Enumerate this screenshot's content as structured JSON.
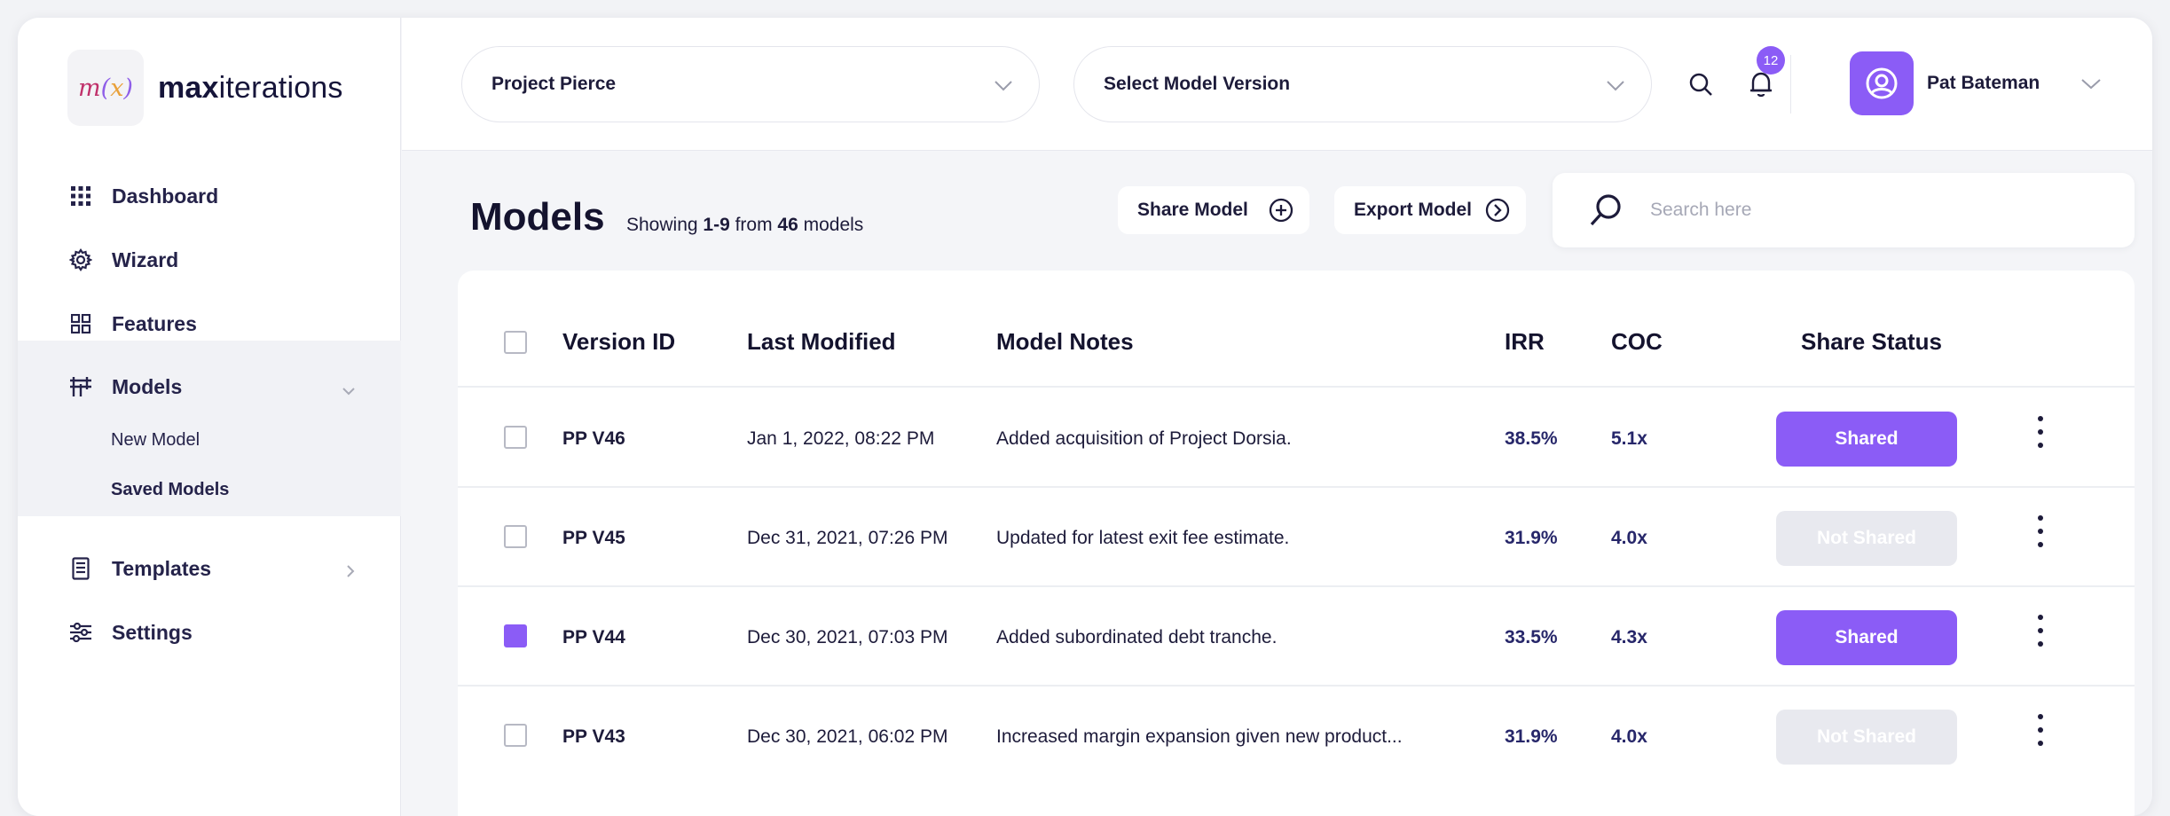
{
  "brand": {
    "logo_m": "m",
    "logo_open": "(",
    "logo_x": "x",
    "logo_close": ")",
    "name_bold": "max",
    "name_rest": "iterations"
  },
  "sidebar": {
    "items": [
      {
        "label": "Dashboard",
        "icon": "grid-dots-icon"
      },
      {
        "label": "Wizard",
        "icon": "gear-icon"
      },
      {
        "label": "Features",
        "icon": "layout-grid-icon"
      },
      {
        "label": "Models",
        "icon": "sliders-icon",
        "expanded": true
      },
      {
        "label": "Templates",
        "icon": "document-icon"
      },
      {
        "label": "Settings",
        "icon": "settings-sliders-icon"
      }
    ],
    "models_sub": [
      {
        "label": "New Model",
        "active": false
      },
      {
        "label": "Saved Models",
        "active": true
      }
    ]
  },
  "topbar": {
    "project_select": "Project Pierce",
    "version_select": "Select Model Version",
    "notification_count": "12",
    "user_name": "Pat Bateman"
  },
  "content": {
    "title": "Models",
    "showing_prefix": "Showing ",
    "showing_range": "1-9",
    "showing_mid": " from ",
    "showing_total": "46",
    "showing_suffix": " models",
    "share_button": "Share Model",
    "export_button": "Export Model",
    "search_placeholder": "Search here"
  },
  "table": {
    "headers": {
      "version_id": "Version ID",
      "last_modified": "Last Modified",
      "model_notes": "Model Notes",
      "irr": "IRR",
      "coc": "COC",
      "share_status": "Share Status"
    },
    "rows": [
      {
        "checked": false,
        "version_id": "PP V46",
        "last_modified": "Jan 1, 2022, 08:22 PM",
        "notes": "Added acquisition of Project Dorsia.",
        "irr": "38.5%",
        "coc": "5.1x",
        "status": "Shared"
      },
      {
        "checked": false,
        "version_id": "PP V45",
        "last_modified": "Dec 31, 2021, 07:26 PM",
        "notes": "Updated for latest exit fee estimate.",
        "irr": "31.9%",
        "coc": "4.0x",
        "status": "Not Shared"
      },
      {
        "checked": true,
        "version_id": "PP V44",
        "last_modified": "Dec 30, 2021, 07:03 PM",
        "notes": "Added subordinated debt tranche.",
        "irr": "33.5%",
        "coc": "4.3x",
        "status": "Shared"
      },
      {
        "checked": false,
        "version_id": "PP V43",
        "last_modified": "Dec 30, 2021, 06:02 PM",
        "notes": "Increased margin expansion given new product...",
        "irr": "31.9%",
        "coc": "4.0x",
        "status": "Not Shared"
      }
    ]
  },
  "colors": {
    "accent": "#8b5cf6",
    "muted_button": "#e8e9ef",
    "text": "#1d1b3a"
  }
}
